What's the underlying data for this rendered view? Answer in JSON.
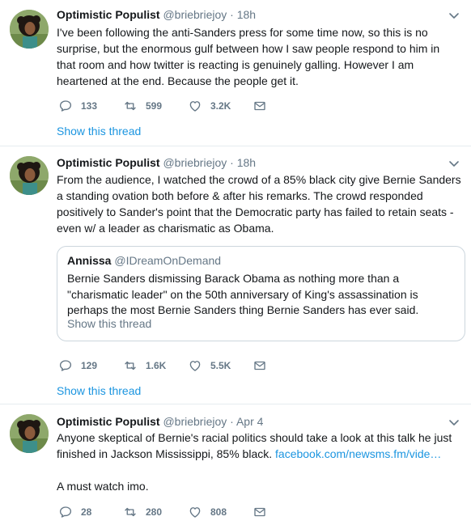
{
  "colors": {
    "accent": "#1b95e0",
    "muted": "#657786",
    "text": "#14171a",
    "divider": "#e6ecf0"
  },
  "tweets": [
    {
      "name": "Optimistic Populist",
      "handle": "@briebriejoy",
      "time": "18h",
      "text": "I've been following the anti-Sanders press for some time now, so this is no surprise, but the enormous gulf between how I saw people respond to him in that room and how twitter is reacting is genuinely galling.  However I am heartened at the end. Because the people get it.",
      "replies": "133",
      "retweets": "599",
      "likes": "3.2K",
      "show_thread": "Show this thread"
    },
    {
      "name": "Optimistic Populist",
      "handle": "@briebriejoy",
      "time": "18h",
      "text": "From the audience, I watched the crowd of a 85% black city give Bernie Sanders a standing ovation both before & after his remarks.  The crowd responded positively to Sander's point that the Democratic party has failed to retain seats - even w/ a leader as charismatic as Obama.",
      "quote": {
        "name": "Annissa",
        "handle": "@IDreamOnDemand",
        "text": "Bernie Sanders dismissing Barack Obama as nothing more than a \"charismatic leader\" on the 50th anniversary of King's assassination is perhaps the most Bernie Sanders thing Bernie Sanders has ever said.",
        "show_thread": "Show this thread"
      },
      "replies": "129",
      "retweets": "1.6K",
      "likes": "5.5K",
      "show_thread": "Show this thread"
    },
    {
      "name": "Optimistic Populist",
      "handle": "@briebriejoy",
      "time": "Apr 4",
      "text": "Anyone skeptical of Bernie's racial politics should take a look at this talk he just finished in Jackson Mississippi, 85% black.",
      "link": "facebook.com/newsms.fm/vide…",
      "text2": "A must watch imo.",
      "replies": "28",
      "retweets": "280",
      "likes": "808"
    }
  ],
  "icons": {
    "avatar": "profile-photo",
    "reply": "reply-icon",
    "retweet": "retweet-icon",
    "like": "heart-icon",
    "dm": "envelope-icon",
    "menu": "chevron-down-icon"
  }
}
